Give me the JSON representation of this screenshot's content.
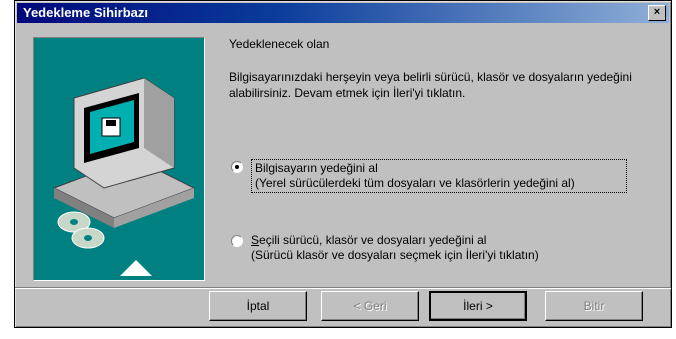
{
  "window": {
    "title": "Yedekleme Sihirbazı",
    "close_label": "×"
  },
  "content": {
    "heading": "Yedeklenecek olan",
    "description": "Bilgisayarınızdaki herşeyin veya belirli sürücü, klasör ve dosyaların yedeğini alabilirsiniz. Devam etmek için İleri'yi tıklatın."
  },
  "options": [
    {
      "line1": "Bilgisayarın yedeğini al",
      "line2": "(Yerel sürücülerdeki tüm dosyaları ve klasörlerin yedeğini al)",
      "selected": true
    },
    {
      "line1_underlined": "S",
      "line1_rest": "eçili sürücü, klasör ve dosyaları yedeğini al",
      "line2": "(Sürücü klasör ve dosyaları seçmek için İleri'yi tıklatın)",
      "selected": false
    }
  ],
  "buttons": {
    "cancel": "İptal",
    "back": "< Geri",
    "next": "İleri >",
    "finish": "Bitir"
  },
  "colors": {
    "titlebar_start": "#00087b",
    "titlebar_end": "#8fb0d8",
    "dialog_bg": "#c0c0c0",
    "art_bg": "#008080"
  },
  "icons": [
    "computer-icon",
    "cd-disc-icon",
    "arrow-up-icon"
  ]
}
